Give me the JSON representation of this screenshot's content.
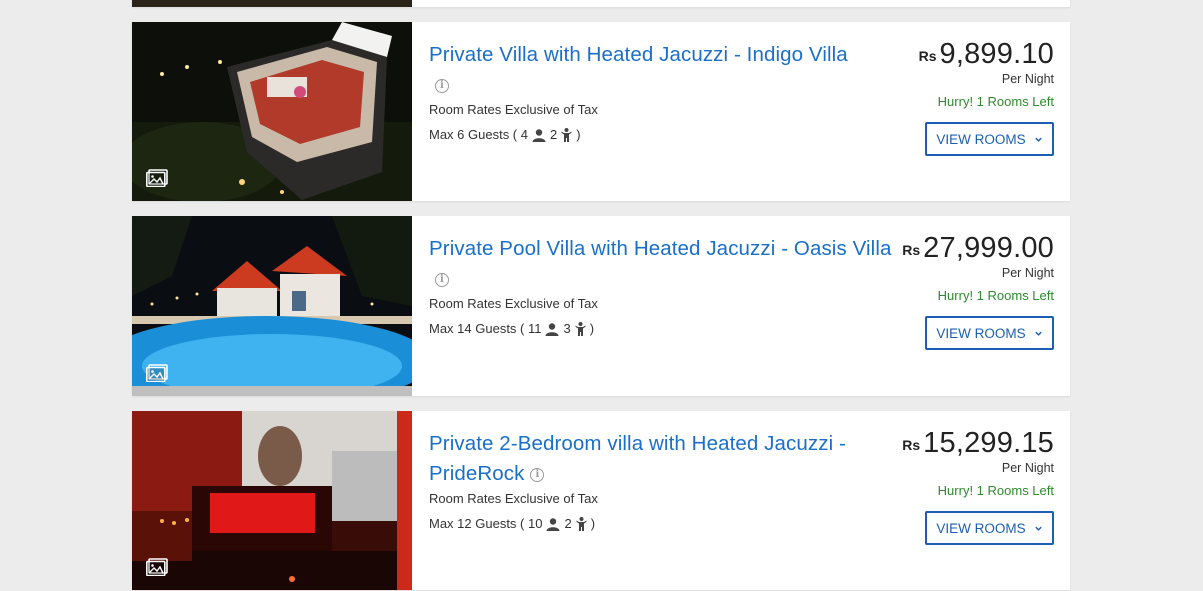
{
  "common": {
    "rate_note": "Room Rates Exclusive of Tax",
    "per_night": "Per Night",
    "currency": "Rs",
    "button_label": "VIEW ROOMS",
    "accent_color": "#1a6fc9",
    "availability_color": "#2e8b2e"
  },
  "listings": [
    {
      "title": "Private Villa with Heated Jacuzzi - Indigo Villa",
      "price": "9,899.10",
      "availability": "Hurry! 1 Rooms Left",
      "guests_prefix": "Max 6 Guests ( ",
      "adults": "4",
      "children": "2",
      "guests_suffix": ")"
    },
    {
      "title": "Private Pool Villa with Heated Jacuzzi - Oasis Villa",
      "price": "27,999.00",
      "availability": "Hurry! 1 Rooms Left",
      "guests_prefix": "Max 14 Guests ( ",
      "adults": "11",
      "children": "3",
      "guests_suffix": ")"
    },
    {
      "title": "Private 2-Bedroom villa with Heated Jacuzzi - PrideRock",
      "price": "15,299.15",
      "availability": "Hurry! 1 Rooms Left",
      "guests_prefix": "Max 12 Guests ( ",
      "adults": "10",
      "children": "2",
      "guests_suffix": ")"
    }
  ]
}
